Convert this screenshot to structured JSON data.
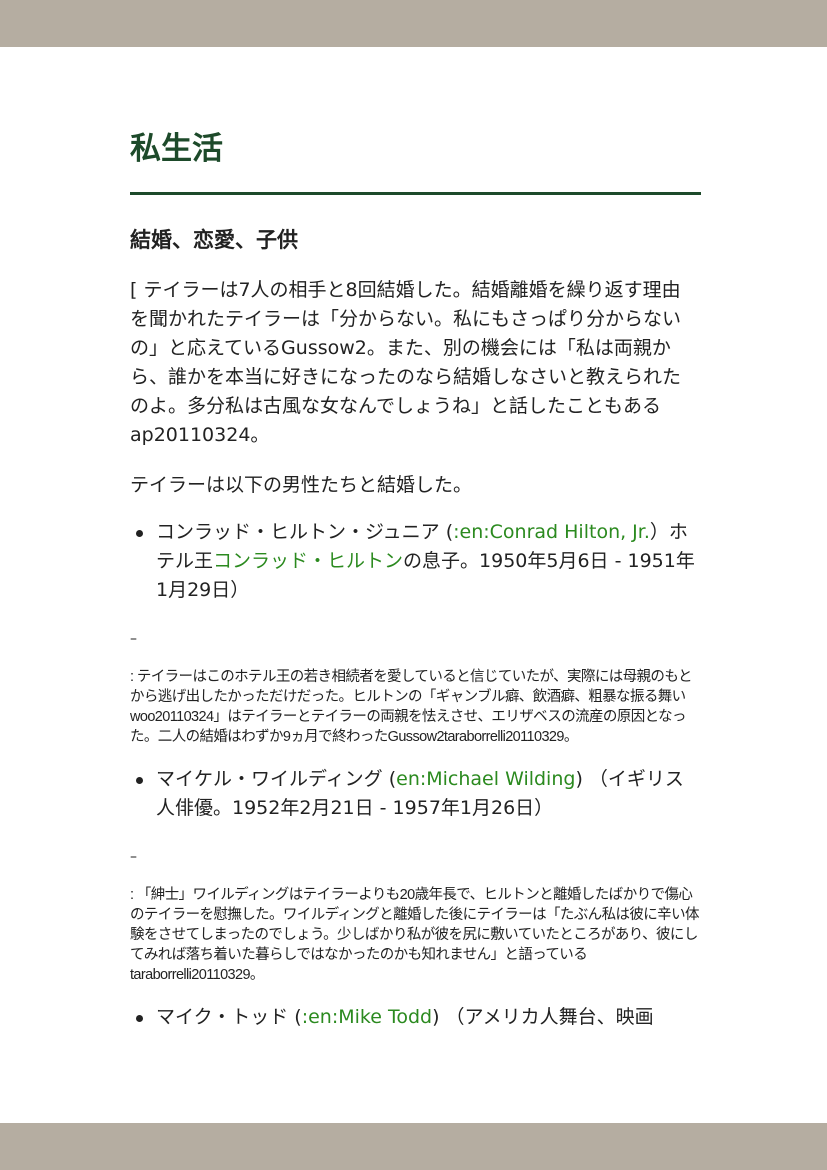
{
  "heading": "私生活",
  "subheading": "結婚、恋愛、子供",
  "intro": "[ テイラーは7人の相手と8回結婚した。結婚離婚を繰り返す理由を聞かれたテイラーは「分からない。私にもさっぱり分からないの」と応えているGussow2。また、別の機会には「私は両親から、誰かを本当に好きになったのなら結婚しなさいと教えられたのよ。多分私は古風な女なんでしょうね」と話したこともあるap20110324。",
  "lead": "テイラーは以下の男性たちと結婚した。",
  "entries": [
    {
      "name": "コンラッド・ヒルトン・ジュニア (",
      "link": ":en:Conrad Hilton, Jr.",
      "after": "）ホテル王",
      "link2": "コンラッド・ヒルトン",
      "after2": "の息子。1950年5月6日 - 1951年1月29日）",
      "dash": "–",
      "note": ": テイラーはこのホテル王の若き相続者を愛していると信じていたが、実際には母親のもとから逃げ出したかっただけだった。ヒルトンの「ギャンブル癖、飲酒癖、粗暴な振る舞いwoo20110324」はテイラーとテイラーの両親を怯えさせ、エリザベスの流産の原因となった。二人の結婚はわずか9ヵ月で終わったGussow2taraborrelli20110329。"
    },
    {
      "name": "マイケル・ワイルディング (",
      "link": "en:Michael Wilding",
      "after": ") （イギリス人俳優。1952年2月21日 - 1957年1月26日）",
      "dash": "–",
      "note": ": 「紳士」ワイルディングはテイラーよりも20歳年長で、ヒルトンと離婚したばかりで傷心のテイラーを慰撫した。ワイルディングと離婚した後にテイラーは「たぶん私は彼に辛い体験をさせてしまったのでしょう。少しばかり私が彼を尻に敷いていたところがあり、彼にしてみれば落ち着いた暮らしではなかったのかも知れません」と語っているtaraborrelli20110329。"
    },
    {
      "name": "マイク・トッド (",
      "link": ":en:Mike Todd",
      "after": ") （アメリカ人舞台、映画"
    }
  ]
}
